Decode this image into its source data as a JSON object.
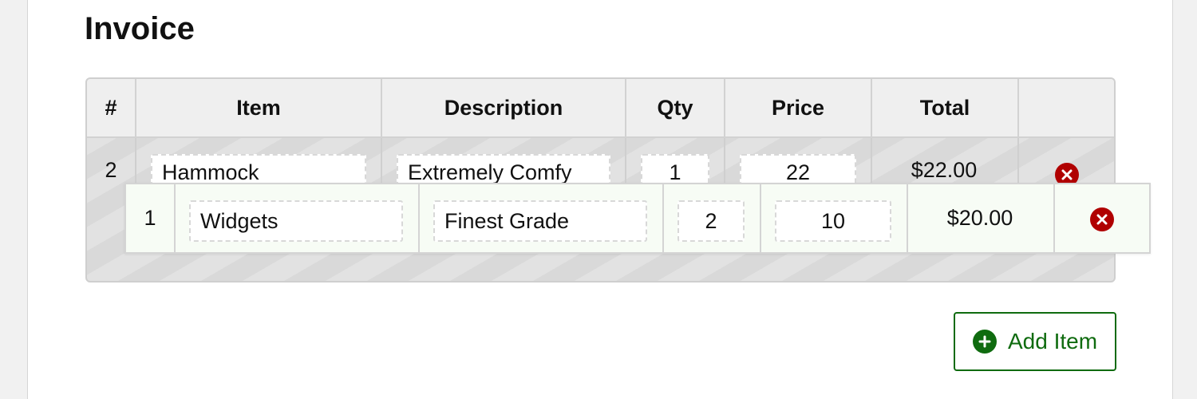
{
  "title": "Invoice",
  "columns": [
    "#",
    "Item",
    "Description",
    "Qty",
    "Price",
    "Total"
  ],
  "rows": [
    {
      "num": "2",
      "item": "Hammock",
      "description": "Extremely Comfy",
      "qty": "1",
      "price": "22",
      "total": "$22.00"
    },
    {
      "num": "1",
      "item": "Widgets",
      "description": "Finest Grade",
      "qty": "2",
      "price": "10",
      "total": "$20.00"
    }
  ],
  "add_button": {
    "label": "Add Item"
  },
  "icons": {
    "remove": "close-circle-icon",
    "add": "plus-circle-icon"
  },
  "colors": {
    "remove": "#b00000",
    "accent": "#0f6b0f",
    "dragged_row_bg": "#f7fcf5"
  }
}
